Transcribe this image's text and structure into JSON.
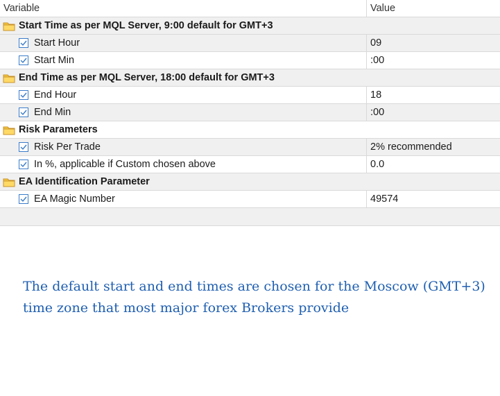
{
  "columns": {
    "variable": "Variable",
    "value": "Value"
  },
  "groups": [
    {
      "title": "Start Time as per MQL Server, 9:00 default for GMT+3",
      "rows": [
        {
          "name": "Start Hour",
          "value": "09"
        },
        {
          "name": "Start Min",
          "value": ":00"
        }
      ]
    },
    {
      "title": "End Time as per MQL Server, 18:00 default for GMT+3",
      "rows": [
        {
          "name": "End Hour",
          "value": "18"
        },
        {
          "name": "End Min",
          "value": ":00"
        }
      ]
    },
    {
      "title": "Risk Parameters",
      "rows": [
        {
          "name": "Risk Per Trade",
          "value": "2% recommended"
        },
        {
          "name": "In %, applicable if Custom chosen above",
          "value": "0.0"
        }
      ]
    },
    {
      "title": "EA Identification Parameter",
      "rows": [
        {
          "name": "EA Magic Number",
          "value": "49574"
        }
      ]
    }
  ],
  "note": "The default start and end times are chosen for the Moscow (GMT+3) time zone that most major forex Brokers provide",
  "colors": {
    "note_text": "#1f5fb0",
    "folder": "#e8b33a",
    "checkbox": "#3a7dc9"
  },
  "icons": {
    "group": "folder-icon",
    "row": "checkbox-icon"
  }
}
